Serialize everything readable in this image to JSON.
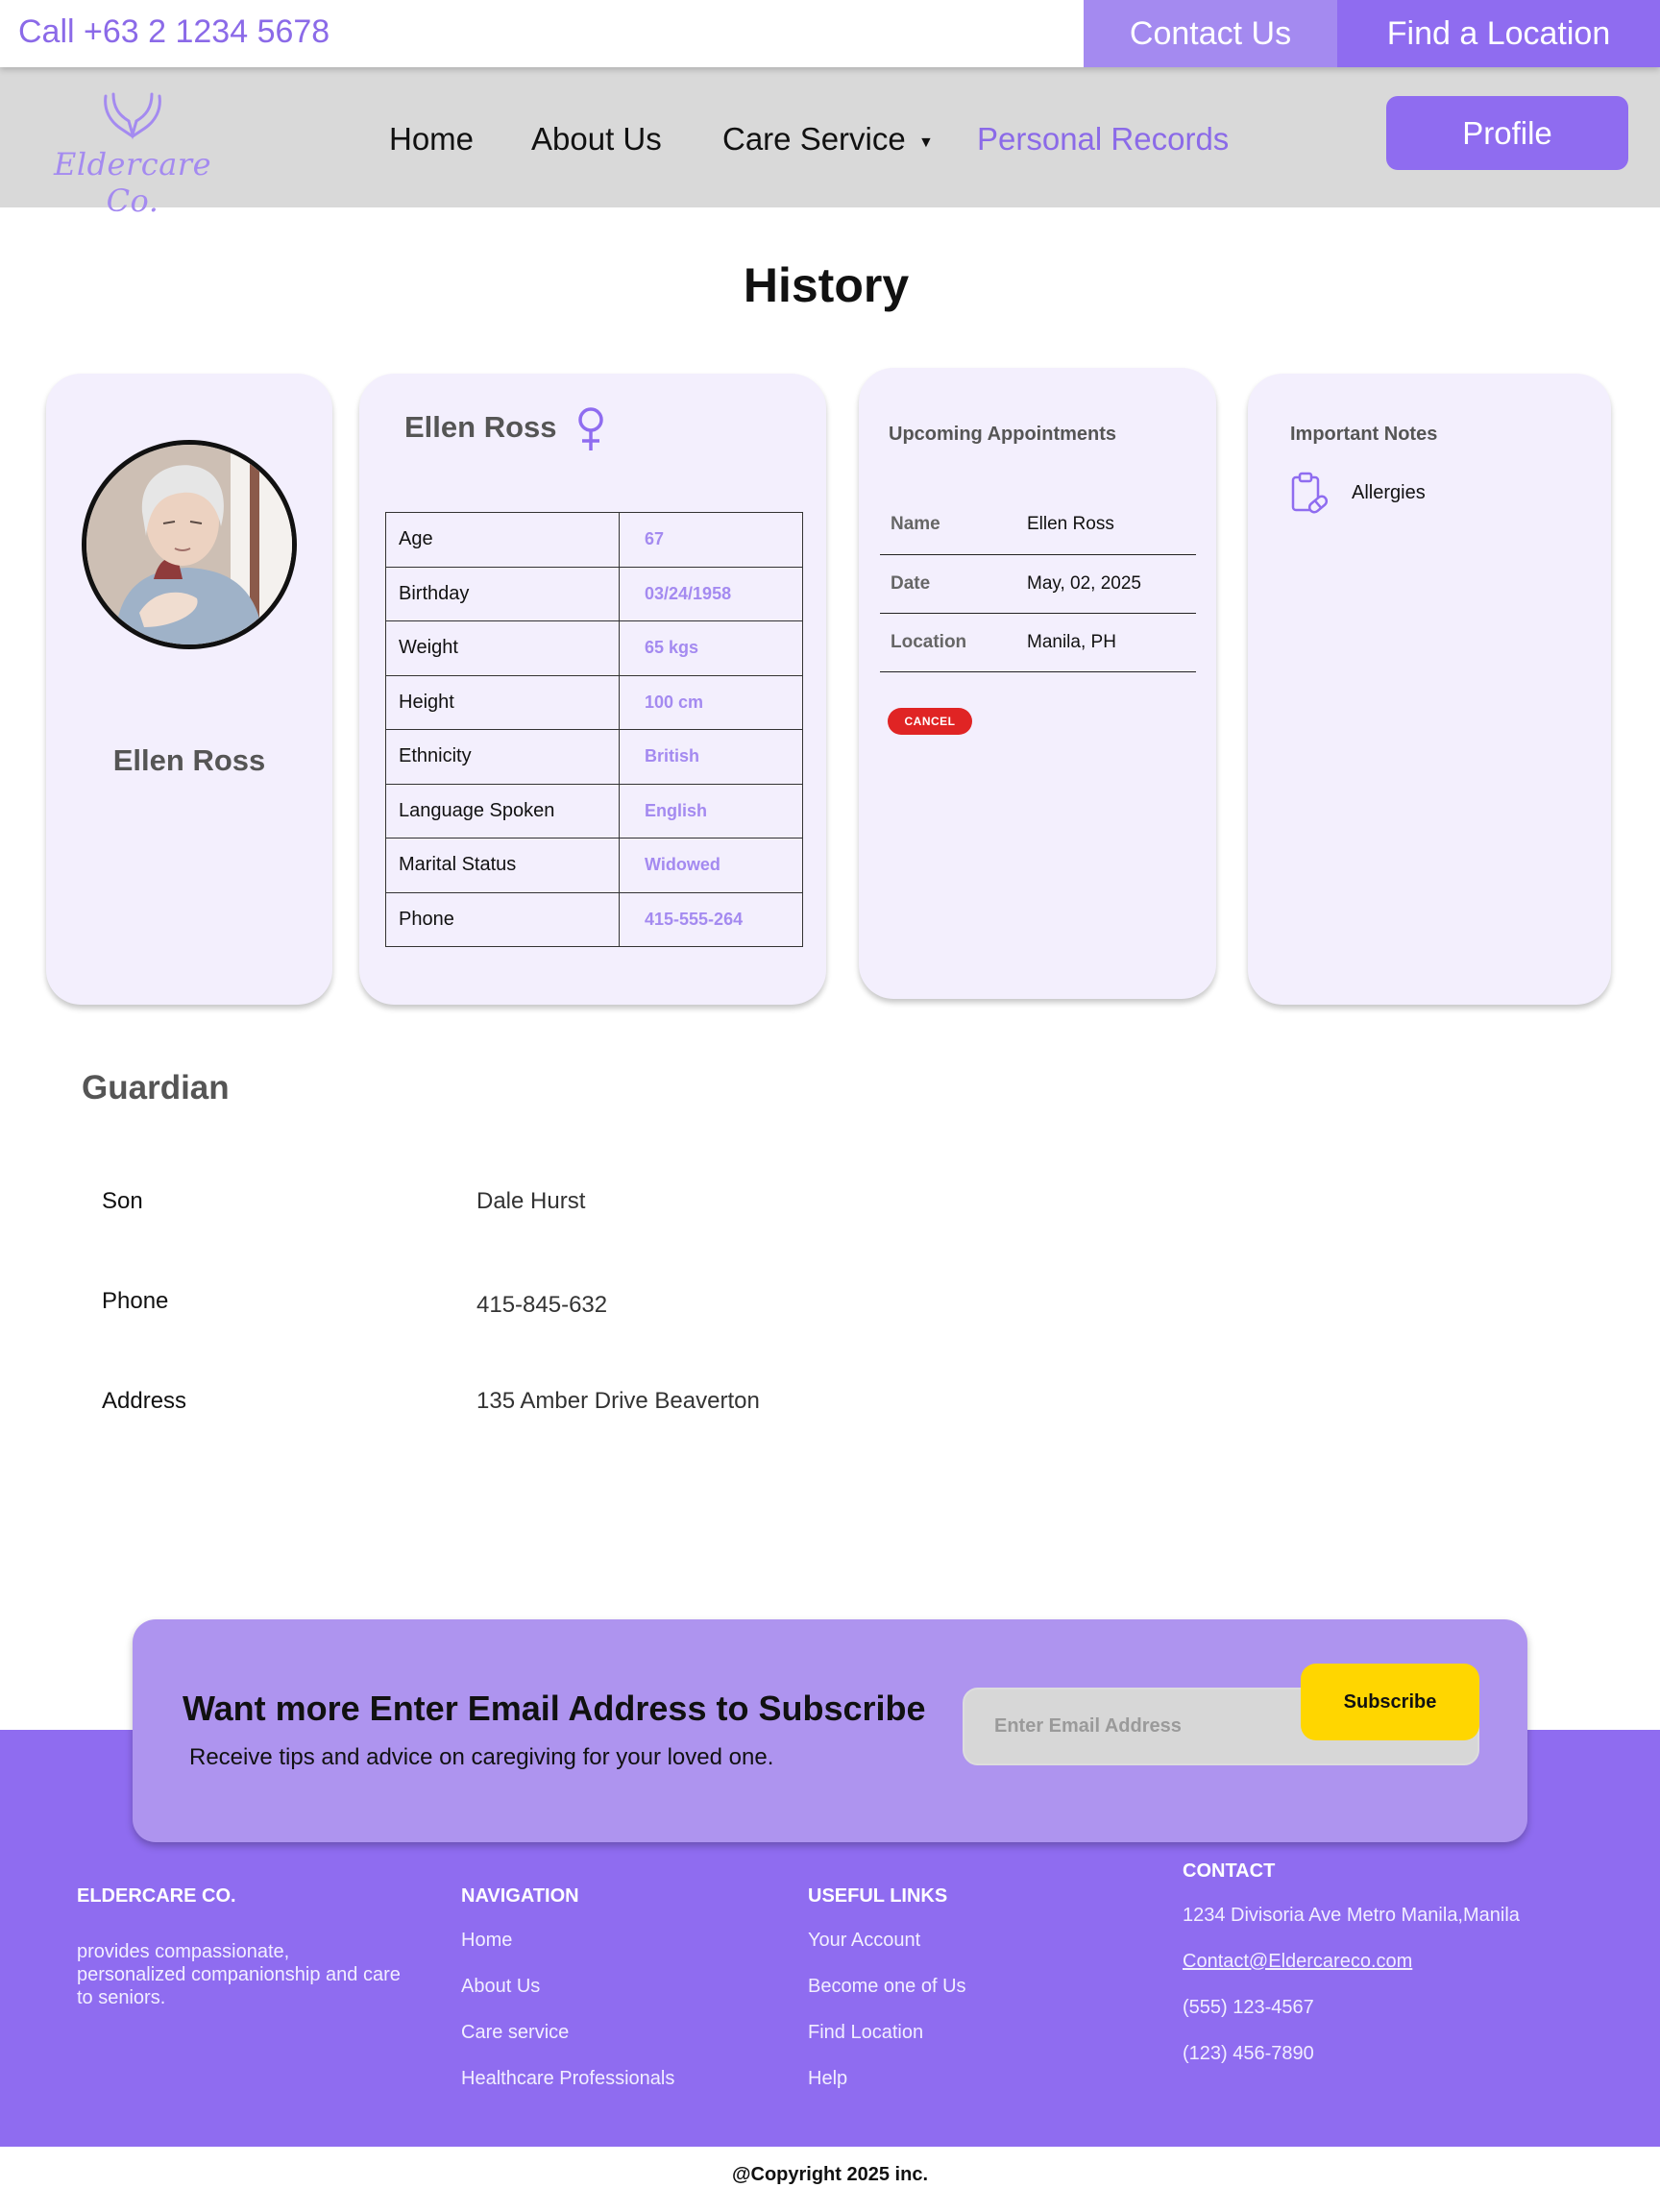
{
  "topbar": {
    "phone": "Call +63 2 1234 5678",
    "contact_label": "Contact Us",
    "find_location_label": "Find a Location"
  },
  "nav": {
    "logo_text": "Eldercare Co.",
    "items": [
      "Home",
      "About Us",
      "Care Service",
      "Personal Records"
    ],
    "active_item": "Personal Records",
    "profile_label": "Profile"
  },
  "page_title": "History",
  "profile": {
    "name": "Ellen Ross"
  },
  "details": {
    "name": "Ellen Ross",
    "rows": [
      {
        "label": "Age",
        "value": "67"
      },
      {
        "label": "Birthday",
        "value": "03/24/1958"
      },
      {
        "label": "Weight",
        "value": "65 kgs"
      },
      {
        "label": "Height",
        "value": "100 cm"
      },
      {
        "label": "Ethnicity",
        "value": "British"
      },
      {
        "label": "Language Spoken",
        "value": "English"
      },
      {
        "label": "Marital Status",
        "value": "Widowed"
      },
      {
        "label": "Phone",
        "value": "415-555-264"
      }
    ]
  },
  "appointments": {
    "title": "Upcoming Appointments",
    "rows": [
      {
        "label": "Name",
        "value": "Ellen Ross"
      },
      {
        "label": "Date",
        "value": "May, 02, 2025"
      },
      {
        "label": "Location",
        "value": "Manila, PH"
      }
    ],
    "cancel_label": "CANCEL"
  },
  "notes": {
    "title": "Important Notes",
    "items": [
      "Allergies"
    ]
  },
  "guardian": {
    "title": "Guardian",
    "rows": [
      {
        "label": "Son",
        "value": "Dale Hurst"
      },
      {
        "label": "Phone",
        "value": "415-845-632"
      },
      {
        "label": "Address",
        "value": "135 Amber Drive Beaverton"
      }
    ]
  },
  "subscribe": {
    "title": "Want more Enter Email Address to Subscribe",
    "text": "Receive tips and advice on caregiving for your loved one.",
    "placeholder": "Enter Email Address",
    "button_label": "Subscribe"
  },
  "footer": {
    "brand_title": "ELDERCARE CO.",
    "brand_text": "provides compassionate, personalized companionship and care to seniors.",
    "navigation_title": "NAVIGATION",
    "navigation_links": [
      "Home",
      "About Us",
      "Care service",
      "Healthcare Professionals"
    ],
    "useful_title": "USEFUL LINKS",
    "useful_links": [
      "Your Account",
      "Become one of Us",
      "Find Location",
      "Help"
    ],
    "contact_title": "CONTACT",
    "contact_address": "1234 Divisoria Ave Metro Manila,Manila",
    "contact_email": "Contact@Eldercareco.com",
    "contact_phone_1": "(555) 123-4567",
    "contact_phone_2": "(123) 456-7890",
    "copyright": "@Copyright 2025 inc."
  },
  "colors": {
    "accent": "#8f6cf0",
    "accent_light": "#a48af0",
    "card_bg": "#f3effd",
    "subscribe_bg": "#ae94ef",
    "subscribe_button": "#ffd600",
    "cancel_red": "#e02424"
  },
  "icons": {
    "logo": "caring-hands-icon",
    "gender": "female-icon",
    "notes": "clipboard-pill-icon",
    "dropdown": "caret-down-icon"
  }
}
